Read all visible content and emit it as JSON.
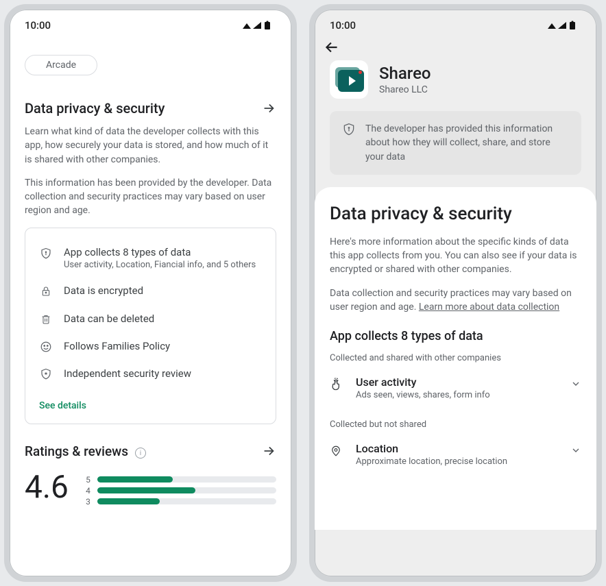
{
  "left": {
    "clock": "10:00",
    "chip": "Arcade",
    "privacy": {
      "title": "Data privacy & security",
      "p1": "Learn what kind of data the developer collects with this app, how securely your data is stored, and how much of it is shared with other companies.",
      "p2": "This information has been provided by the developer. Data collection and security practices may vary based on user region and age."
    },
    "card": {
      "collect_title": "App collects 8 types of data",
      "collect_sub": "User activity, Location, Fiancial info, and 5 others",
      "encrypted": "Data is encrypted",
      "deleted": "Data can be deleted",
      "families": "Follows Families Policy",
      "independent": "Independent security review",
      "see_details": "See details"
    },
    "reviews": {
      "title": "Ratings & reviews",
      "avg": "4.6",
      "bars": [
        {
          "label": "5",
          "pct": 42
        },
        {
          "label": "4",
          "pct": 55
        },
        {
          "label": "3",
          "pct": 35
        }
      ]
    }
  },
  "right": {
    "clock": "10:00",
    "app_name": "Shareo",
    "app_dev": "Shareo LLC",
    "notice": "The developer has provided this information about how they will collect, share, and store your data",
    "title": "Data privacy & security",
    "p1": "Here's more information about the specific kinds of data this app collects from you. You can also see if your data is encrypted or shared with other companies.",
    "p2_prefix": "Data collection and security practices may vary based on user region and age. ",
    "p2_link": "Learn more about data collection",
    "subhead": "App collects 8 types of data",
    "hint1": "Collected and shared with other companies",
    "row1": {
      "title": "User activity",
      "sub": "Ads seen, views, shares, form info"
    },
    "hint2": "Collected but not shared",
    "row2": {
      "title": "Location",
      "sub": "Approximate location, precise location"
    }
  }
}
